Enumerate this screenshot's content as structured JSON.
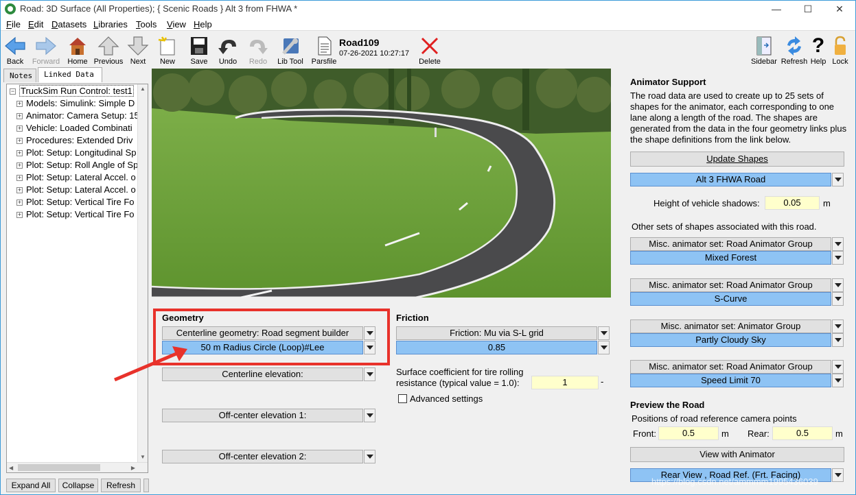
{
  "window": {
    "title": "Road: 3D Surface (All Properties);  { Scenic Roads }  Alt 3 from FHWA *"
  },
  "menu": [
    "File",
    "Edit",
    "Datasets",
    "Libraries",
    "Tools",
    "View",
    "Help"
  ],
  "menu_underline": [
    "F",
    "E",
    "D",
    "L",
    "T",
    "V",
    "H"
  ],
  "toolbar": {
    "back": "Back",
    "forward": "Forward",
    "home": "Home",
    "previous": "Previous",
    "next": "Next",
    "new": "New",
    "save": "Save",
    "undo": "Undo",
    "redo": "Redo",
    "libtool": "Lib Tool",
    "parsfile": "Parsfile",
    "delete": "Delete",
    "sidebar": "Sidebar",
    "refresh": "Refresh",
    "help": "Help",
    "lock": "Lock"
  },
  "dataset": {
    "name": "Road109",
    "timestamp": "07-26-2021 10:27:17"
  },
  "left_pane": {
    "tabs": [
      "Notes",
      "Linked Data"
    ],
    "tree_root": "TruckSim Run Control: test1",
    "tree_items": [
      "Models: Simulink: Simple D",
      "Animator: Camera Setup: 15",
      "Vehicle: Loaded Combinati",
      "Procedures: Extended Driv",
      "Plot: Setup: Longitudinal Sp",
      "Plot: Setup: Roll Angle of Sp",
      "Plot: Setup: Lateral Accel. o",
      "Plot: Setup: Lateral Accel. o",
      "Plot: Setup: Vertical Tire Fo",
      "Plot: Setup: Vertical Tire Fo"
    ],
    "buttons": {
      "expand": "Expand All",
      "collapse": "Collapse",
      "refresh": "Refresh"
    }
  },
  "geometry": {
    "title": "Geometry",
    "centerline_link": "Centerline geometry: Road segment builder",
    "centerline_value": "50 m Radius Circle (Loop)#Lee",
    "centerline_elevation": "Centerline elevation:",
    "offcenter1": "Off-center elevation 1:",
    "offcenter2": "Off-center elevation 2:"
  },
  "friction": {
    "title": "Friction",
    "link": "Friction: Mu via S-L grid",
    "value": "0.85",
    "surface_line1": "Surface coefficient for tire rolling",
    "surface_line2": "resistance (typical value = 1.0):",
    "surface_value": "1",
    "surface_unit": "-",
    "advanced": "Advanced settings"
  },
  "animator": {
    "title": "Animator Support",
    "desc": [
      "The road data are used to create up to 25 sets of",
      "shapes for the animator, each corresponding to one",
      "lane along a length of the road. The shapes are",
      "generated from the data in the four geometry links plus",
      "the shape definitions from the link below."
    ],
    "update_shapes": "Update Shapes",
    "road_shape": "Alt 3 FHWA Road",
    "shadow_label": "Height of vehicle shadows:",
    "shadow_value": "0.05",
    "shadow_unit": "m",
    "other_sets": "Other sets of shapes associated with this road.",
    "sets": [
      {
        "link": "Misc. animator set: Road Animator Group",
        "value": "Mixed Forest"
      },
      {
        "link": "Misc. animator set: Road Animator Group",
        "value": "S-Curve"
      },
      {
        "link": "Misc. animator set: Animator Group",
        "value": "Partly Cloudy Sky"
      },
      {
        "link": "Misc. animator set: Road Animator Group",
        "value": "Speed Limit 70"
      }
    ]
  },
  "preview": {
    "title": "Preview the Road",
    "subtitle": "Positions of road reference camera points",
    "front_label": "Front:",
    "front_value": "0.5",
    "front_unit": "m",
    "rear_label": "Rear:",
    "rear_value": "0.5",
    "rear_unit": "m",
    "view_button": "View with Animator",
    "camera_value": "Rear View , Road Ref. (Frt. Facing)"
  },
  "watermark": "https://blog.csdn.net/ammmm1995436039",
  "colors": {
    "accent_blue": "#8ec3f4",
    "highlight_red": "#e8322b",
    "input_yellow": "#ffffcc"
  }
}
